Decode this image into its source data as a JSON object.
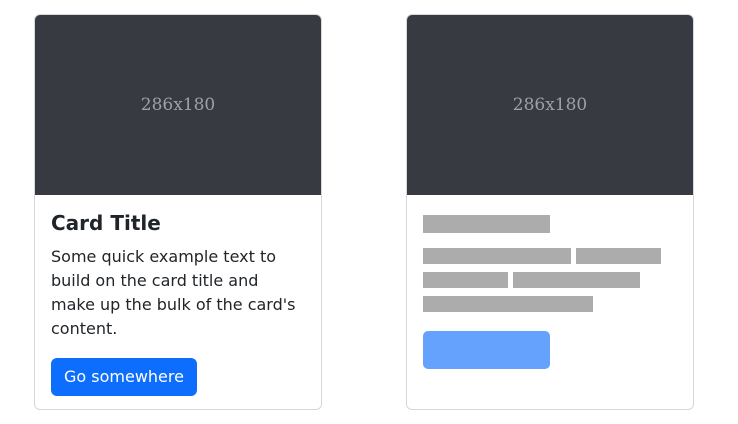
{
  "cards": [
    {
      "image_label": "286x180",
      "title": "Card Title",
      "text": "Some quick example text to build on the card title and make up the bulk of the card's content.",
      "button_label": "Go somewhere"
    },
    {
      "image_label": "286x180",
      "loading": true
    }
  ],
  "colors": {
    "image_bg": "#373a41",
    "primary": "#0d6efd",
    "placeholder": "#acacac",
    "placeholder_button": "#65a2fd"
  }
}
